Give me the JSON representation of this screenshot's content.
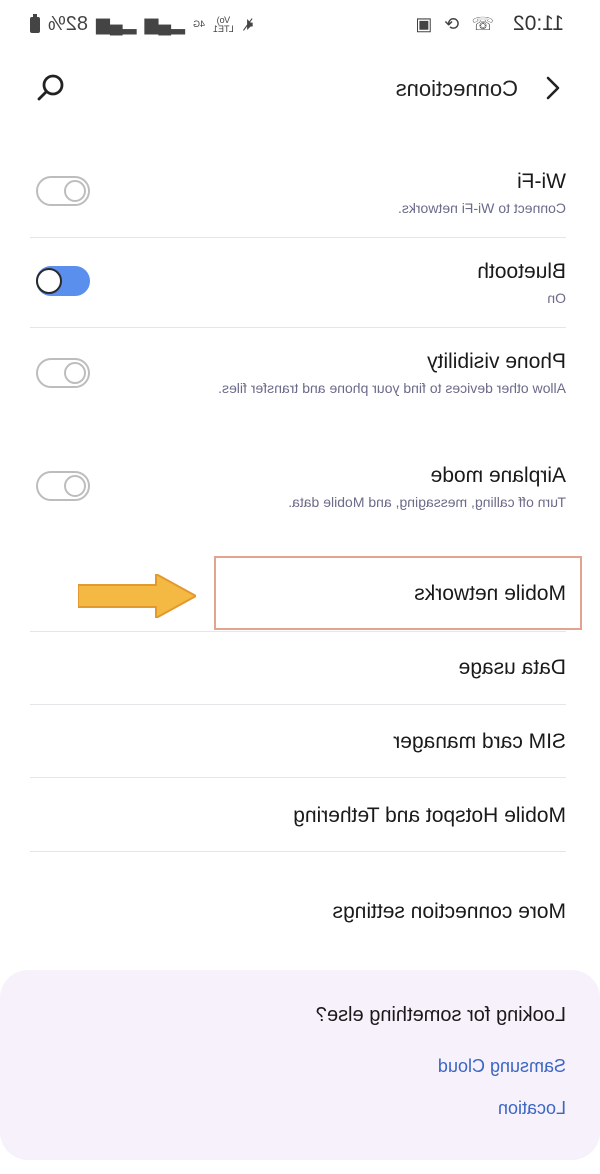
{
  "status_bar": {
    "time": "11:02",
    "battery": "82%",
    "network": "4G",
    "lte": "LTE1",
    "volte": "Vo)"
  },
  "header": {
    "title": "Connections"
  },
  "rows": [
    {
      "title": "Wi-Fi",
      "subtitle": "Connect to Wi-Fi networks.",
      "toggle": false
    },
    {
      "title": "Bluetooth",
      "subtitle": "On",
      "toggle": true
    },
    {
      "title": "Phone visibility",
      "subtitle": "Allow other devices to find your phone and transfer files.",
      "toggle": false
    },
    {
      "title": "Airplane mode",
      "subtitle": "Turn off calling, messaging, and Mobile data.",
      "toggle": false
    }
  ],
  "menu": {
    "mobile_networks": "Mobile networks",
    "data_usage": "Data usage",
    "sim_card_manager": "SIM card manager",
    "hotspot": "Mobile Hotspot and Tethering",
    "more": "More connection settings"
  },
  "suggestions": {
    "title": "Looking for something else?",
    "links": [
      "Samsung Cloud",
      "Location"
    ]
  },
  "colors": {
    "toggle_on": "#5a8fee",
    "link": "#3b66c4",
    "highlight": "#e3a48f",
    "arrow": "#f4b942"
  }
}
